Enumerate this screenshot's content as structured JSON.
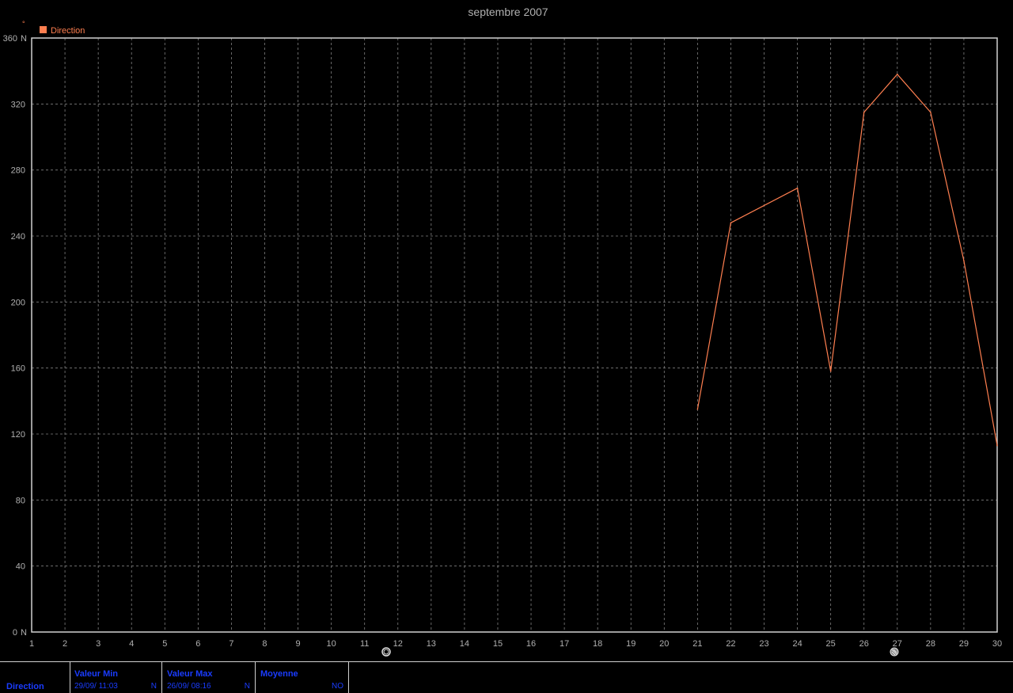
{
  "chart_data": {
    "type": "line",
    "title": "septembre 2007",
    "legend": [
      "Direction"
    ],
    "legend_position": "top-left",
    "unit_marker": "°",
    "x": [
      21,
      22,
      24,
      25,
      26,
      27,
      28,
      29,
      30
    ],
    "series": [
      {
        "name": "Direction",
        "color": "#ff7f50",
        "values": [
          135,
          248,
          269,
          158,
          315,
          338,
          315,
          225,
          113
        ]
      }
    ],
    "xlim": [
      1,
      30
    ],
    "ylim": [
      0,
      360
    ],
    "x_ticks": [
      "1",
      "2",
      "3",
      "4",
      "5",
      "6",
      "7",
      "8",
      "9",
      "10",
      "11",
      "12",
      "13",
      "14",
      "15",
      "16",
      "17",
      "18",
      "19",
      "20",
      "21",
      "22",
      "23",
      "24",
      "25",
      "26",
      "27",
      "28",
      "29",
      "30"
    ],
    "y_ticks": [
      0,
      40,
      80,
      120,
      160,
      200,
      240,
      280,
      320,
      360
    ],
    "y_tick_labels": [
      "0",
      "40",
      "80",
      "120",
      "160",
      "200",
      "240",
      "280",
      "320",
      "360"
    ],
    "y_compass_labels": {
      "0": "N",
      "360": "N"
    },
    "grid": true
  },
  "colors": {
    "background": "#000000",
    "axis": "#d0d0d0",
    "grid": "#808080",
    "title": "#b0b0b0",
    "series": "#ff7f50",
    "stats_text": "#1a3cff"
  },
  "icons": {
    "moon_phase_1": "new-moon-icon",
    "moon_phase_2": "full-moon-icon"
  },
  "stats": {
    "series_label": "Direction",
    "min": {
      "label": "Valeur Min",
      "date": "29/09/ 11:03",
      "value": "N"
    },
    "max": {
      "label": "Valeur Max",
      "date": "26/09/ 08:16",
      "value": "N"
    },
    "avg": {
      "label": "Moyenne",
      "value": "NO"
    }
  }
}
